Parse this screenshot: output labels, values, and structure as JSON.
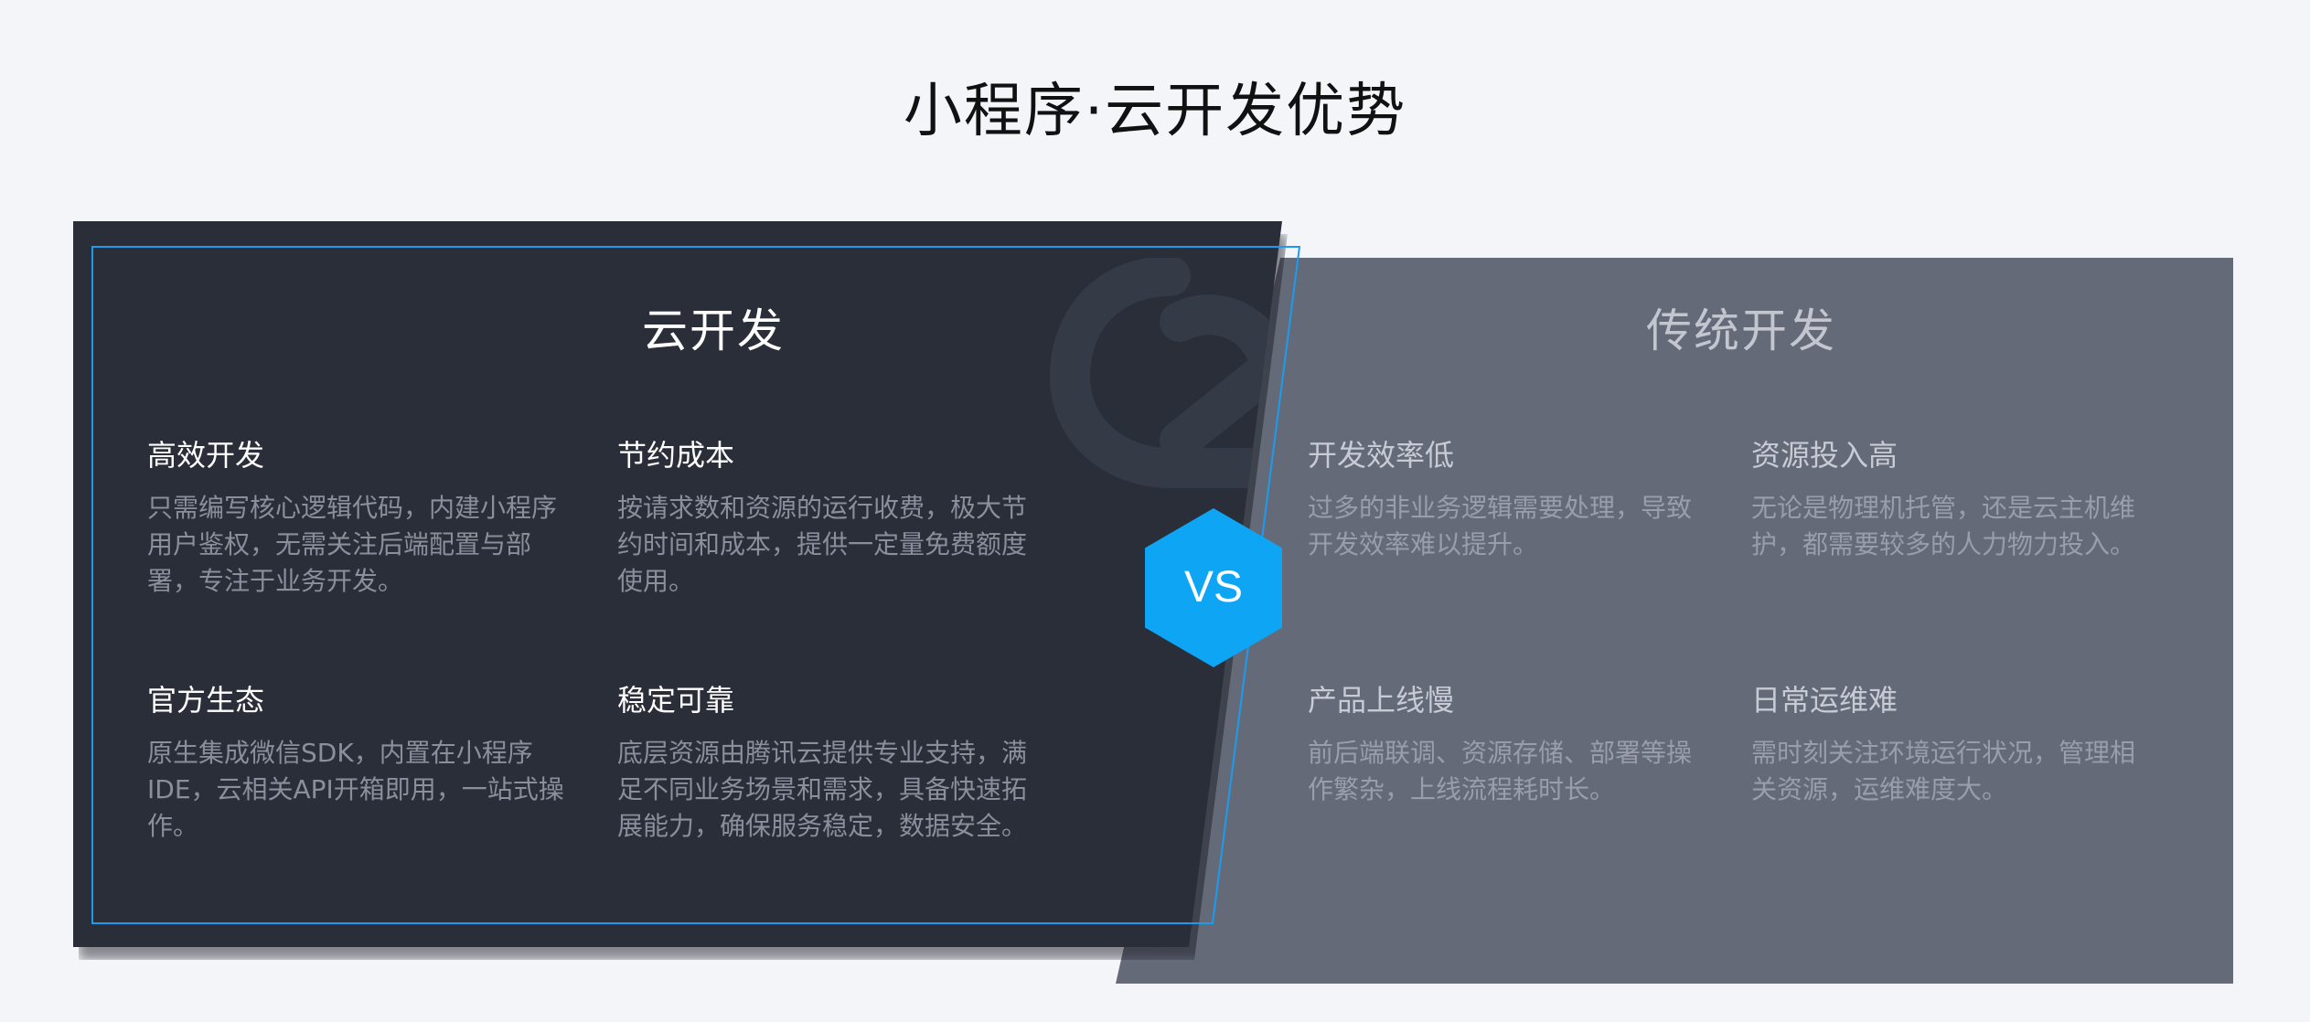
{
  "title": "小程序·云开发优势",
  "badge": "VS",
  "colors": {
    "background": "#f4f5f9",
    "cloud_panel": "#2a2e39",
    "traditional_panel": "#656a79",
    "accent": "#0ea5f4",
    "frame": "#1b9cf0"
  },
  "cloud": {
    "title": "云开发",
    "features": [
      {
        "title": "高效开发",
        "lines": [
          "只需编写核心逻辑代码，内建小程序",
          "用户鉴权，无需关注后端配置与部",
          "署，专注于业务开发。"
        ]
      },
      {
        "title": "节约成本",
        "lines": [
          "按请求数和资源的运行收费，极大节",
          "约时间和成本，提供一定量免费额度",
          "使用。"
        ]
      },
      {
        "title": "官方生态",
        "lines": [
          "原生集成微信SDK，内置在小程序",
          "IDE，云相关API开箱即用，一站式操",
          "作。"
        ]
      },
      {
        "title": "稳定可靠",
        "lines": [
          "底层资源由腾讯云提供专业支持，满",
          "足不同业务场景和需求，具备快速拓",
          "展能力，确保服务稳定，数据安全。"
        ]
      }
    ]
  },
  "traditional": {
    "title": "传统开发",
    "features": [
      {
        "title": "开发效率低",
        "lines": [
          "过多的非业务逻辑需要处理，导致",
          "开发效率难以提升。"
        ]
      },
      {
        "title": "资源投入高",
        "lines": [
          "无论是物理机托管，还是云主机维",
          "护，都需要较多的人力物力投入。"
        ]
      },
      {
        "title": "产品上线慢",
        "lines": [
          "前后端联调、资源存储、部署等操",
          "作繁杂，上线流程耗时长。"
        ]
      },
      {
        "title": "日常运维难",
        "lines": [
          "需时刻关注环境运行状况，管理相",
          "关资源，运维难度大。"
        ]
      }
    ]
  }
}
